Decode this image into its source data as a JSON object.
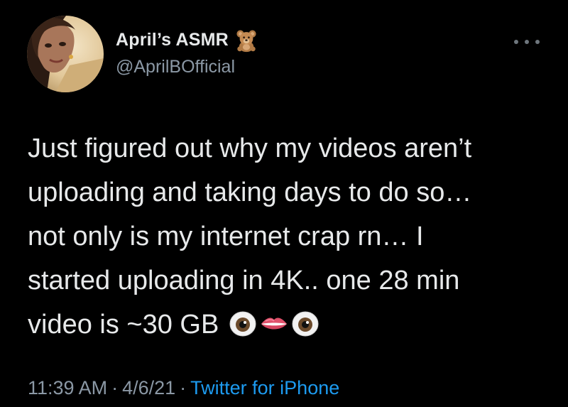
{
  "tweet": {
    "author": {
      "display_name": "April’s ASMR",
      "name_emoji": "teddy-bear-icon",
      "handle": "@AprilBOfficial",
      "avatar": "profile-photo"
    },
    "text_lines": [
      "Just figured out why my videos aren’t",
      "uploading and taking days to do so…",
      "not only is my internet crap rn… I",
      "started uploading in 4K.. one 28 min",
      "video is ~30 GB"
    ],
    "trailing_emojis": [
      "eye-icon",
      "lips-icon",
      "eye-icon"
    ],
    "time": "11:39 AM",
    "separator": "·",
    "date": "4/6/21",
    "source": "Twitter for iPhone"
  },
  "colors": {
    "background": "#000000",
    "text": "#e7e9ea",
    "secondary": "#8b98a5",
    "link": "#1d9bf0"
  }
}
